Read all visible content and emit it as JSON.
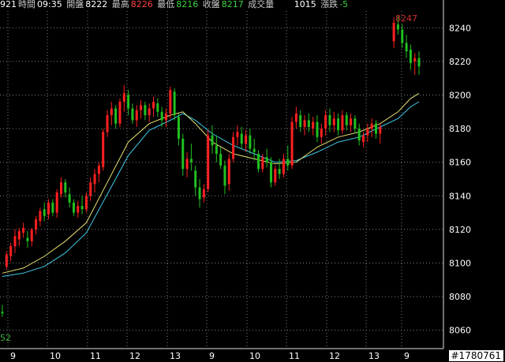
{
  "header": {
    "code_fragment": "921",
    "time_label": "時間",
    "time": "09:35",
    "open_label": "開盤",
    "open": "8222",
    "high_label": "最高",
    "high": "8226",
    "low_label": "最低",
    "low": "8216",
    "close_label": "收盤",
    "close": "8217",
    "volume_label": "成交量",
    "volume": "1015",
    "change_label": "漲跌",
    "change": "-5"
  },
  "watermark": "#1780761",
  "colors": {
    "background": "#000000",
    "up": "#ff2020",
    "down": "#20c020",
    "ma_short": "#e8e070",
    "ma_long": "#40c8e8",
    "grid": "#808080",
    "axis_text": "#ffffff"
  },
  "chart_data": {
    "type": "candlestick",
    "ylim": [
      8050,
      8250
    ],
    "yticks": [
      8060,
      8080,
      8100,
      8120,
      8140,
      8160,
      8180,
      8200,
      8220,
      8240
    ],
    "xtick_labels": [
      "9",
      "10",
      "11",
      "12",
      "13",
      "9",
      "10",
      "11",
      "12",
      "13",
      "9"
    ],
    "annotations": {
      "max_value": "8247",
      "left_partial_label": "52"
    },
    "candles": [
      [
        8071,
        8075,
        8068,
        8070
      ],
      [
        8098,
        8107,
        8096,
        8105
      ],
      [
        8104,
        8112,
        8101,
        8110
      ],
      [
        8110,
        8120,
        8106,
        8116
      ],
      [
        8114,
        8121,
        8110,
        8119
      ],
      [
        8118,
        8124,
        8115,
        8121
      ],
      [
        8115,
        8119,
        8109,
        8113
      ],
      [
        8113,
        8121,
        8110,
        8120
      ],
      [
        8120,
        8128,
        8117,
        8126
      ],
      [
        8125,
        8133,
        8122,
        8131
      ],
      [
        8132,
        8136,
        8125,
        8128
      ],
      [
        8129,
        8138,
        8126,
        8136
      ],
      [
        8136,
        8138,
        8128,
        8130
      ],
      [
        8130,
        8144,
        8127,
        8142
      ],
      [
        8141,
        8151,
        8139,
        8148
      ],
      [
        8148,
        8150,
        8139,
        8142
      ],
      [
        8141,
        8145,
        8133,
        8136
      ],
      [
        8136,
        8138,
        8128,
        8130
      ],
      [
        8130,
        8137,
        8127,
        8134
      ],
      [
        8134,
        8140,
        8129,
        8132
      ],
      [
        8132,
        8142,
        8130,
        8140
      ],
      [
        8140,
        8151,
        8137,
        8148
      ],
      [
        8147,
        8156,
        8142,
        8153
      ],
      [
        8153,
        8160,
        8148,
        8158
      ],
      [
        8157,
        8180,
        8155,
        8178
      ],
      [
        8178,
        8191,
        8175,
        8188
      ],
      [
        8188,
        8196,
        8182,
        8192
      ],
      [
        8192,
        8194,
        8180,
        8183
      ],
      [
        8183,
        8198,
        8181,
        8196
      ],
      [
        8196,
        8206,
        8190,
        8201
      ],
      [
        8200,
        8203,
        8188,
        8192
      ],
      [
        8192,
        8195,
        8183,
        8185
      ],
      [
        8185,
        8194,
        8181,
        8191
      ],
      [
        8191,
        8197,
        8186,
        8194
      ],
      [
        8194,
        8196,
        8185,
        8188
      ],
      [
        8188,
        8195,
        8184,
        8192
      ],
      [
        8192,
        8199,
        8187,
        8196
      ],
      [
        8195,
        8198,
        8187,
        8190
      ],
      [
        8190,
        8193,
        8181,
        8185
      ],
      [
        8185,
        8192,
        8181,
        8189
      ],
      [
        8189,
        8205,
        8186,
        8203
      ],
      [
        8202,
        8204,
        8185,
        8188
      ],
      [
        8187,
        8189,
        8170,
        8174
      ],
      [
        8174,
        8177,
        8152,
        8156
      ],
      [
        8156,
        8166,
        8151,
        8162
      ],
      [
        8162,
        8171,
        8155,
        8160
      ],
      [
        8155,
        8158,
        8140,
        8145
      ],
      [
        8145,
        8150,
        8133,
        8138
      ],
      [
        8139,
        8147,
        8136,
        8144
      ],
      [
        8144,
        8179,
        8142,
        8176
      ],
      [
        8176,
        8182,
        8165,
        8170
      ],
      [
        8170,
        8176,
        8160,
        8165
      ],
      [
        8165,
        8169,
        8156,
        8158
      ],
      [
        8158,
        8161,
        8141,
        8146
      ],
      [
        8147,
        8165,
        8143,
        8162
      ],
      [
        8162,
        8178,
        8160,
        8175
      ],
      [
        8175,
        8182,
        8170,
        8178
      ],
      [
        8177,
        8181,
        8168,
        8171
      ],
      [
        8171,
        8179,
        8166,
        8176
      ],
      [
        8176,
        8180,
        8165,
        8168
      ],
      [
        8168,
        8174,
        8161,
        8166
      ],
      [
        8165,
        8167,
        8154,
        8156
      ],
      [
        8156,
        8165,
        8154,
        8163
      ],
      [
        8163,
        8168,
        8157,
        8160
      ],
      [
        8160,
        8163,
        8145,
        8148
      ],
      [
        8148,
        8158,
        8146,
        8156
      ],
      [
        8156,
        8162,
        8150,
        8153
      ],
      [
        8153,
        8165,
        8151,
        8162
      ],
      [
        8162,
        8170,
        8155,
        8158
      ],
      [
        8158,
        8187,
        8156,
        8184
      ],
      [
        8184,
        8193,
        8180,
        8189
      ],
      [
        8188,
        8191,
        8178,
        8181
      ],
      [
        8181,
        8188,
        8176,
        8185
      ],
      [
        8185,
        8189,
        8178,
        8181
      ],
      [
        8180,
        8187,
        8176,
        8184
      ],
      [
        8184,
        8188,
        8172,
        8175
      ],
      [
        8175,
        8183,
        8171,
        8180
      ],
      [
        8180,
        8191,
        8176,
        8188
      ],
      [
        8188,
        8192,
        8178,
        8182
      ],
      [
        8182,
        8190,
        8178,
        8186
      ],
      [
        8186,
        8189,
        8176,
        8179
      ],
      [
        8179,
        8191,
        8177,
        8188
      ],
      [
        8188,
        8190,
        8179,
        8182
      ],
      [
        8182,
        8189,
        8178,
        8186
      ],
      [
        8186,
        8188,
        8177,
        8180
      ],
      [
        8180,
        8183,
        8170,
        8173
      ],
      [
        8172,
        8178,
        8169,
        8176
      ],
      [
        8176,
        8183,
        8172,
        8180
      ],
      [
        8180,
        8186,
        8175,
        8183
      ],
      [
        8183,
        8185,
        8174,
        8177
      ],
      [
        8177,
        8183,
        8171,
        8181
      ],
      [
        8232,
        8246,
        8228,
        8243
      ],
      [
        8242,
        8247,
        8236,
        8239
      ],
      [
        8239,
        8242,
        8228,
        8231
      ],
      [
        8231,
        8236,
        8222,
        8226
      ],
      [
        8227,
        8230,
        8215,
        8219
      ],
      [
        8220,
        8225,
        8212,
        8222
      ],
      [
        8222,
        8226,
        8212,
        8217
      ]
    ],
    "gap_after_index": 90,
    "ma_short": [
      [
        0,
        8094
      ],
      [
        5,
        8097
      ],
      [
        10,
        8104
      ],
      [
        15,
        8113
      ],
      [
        20,
        8124
      ],
      [
        25,
        8148
      ],
      [
        30,
        8172
      ],
      [
        35,
        8183
      ],
      [
        40,
        8188
      ],
      [
        43,
        8190
      ],
      [
        46,
        8183
      ],
      [
        50,
        8172
      ],
      [
        55,
        8165
      ],
      [
        60,
        8162
      ],
      [
        65,
        8159
      ],
      [
        70,
        8160
      ],
      [
        75,
        8169
      ],
      [
        80,
        8175
      ],
      [
        85,
        8178
      ],
      [
        90,
        8183
      ],
      [
        92,
        8190
      ],
      [
        95,
        8198
      ],
      [
        97,
        8201
      ]
    ],
    "ma_long": [
      [
        0,
        8092
      ],
      [
        5,
        8094
      ],
      [
        10,
        8098
      ],
      [
        15,
        8106
      ],
      [
        20,
        8118
      ],
      [
        25,
        8141
      ],
      [
        30,
        8164
      ],
      [
        35,
        8179
      ],
      [
        40,
        8185
      ],
      [
        43,
        8189
      ],
      [
        46,
        8185
      ],
      [
        50,
        8177
      ],
      [
        55,
        8170
      ],
      [
        60,
        8165
      ],
      [
        65,
        8160
      ],
      [
        70,
        8161
      ],
      [
        75,
        8166
      ],
      [
        80,
        8172
      ],
      [
        85,
        8175
      ],
      [
        90,
        8181
      ],
      [
        92,
        8186
      ],
      [
        95,
        8193
      ],
      [
        97,
        8196
      ]
    ]
  }
}
